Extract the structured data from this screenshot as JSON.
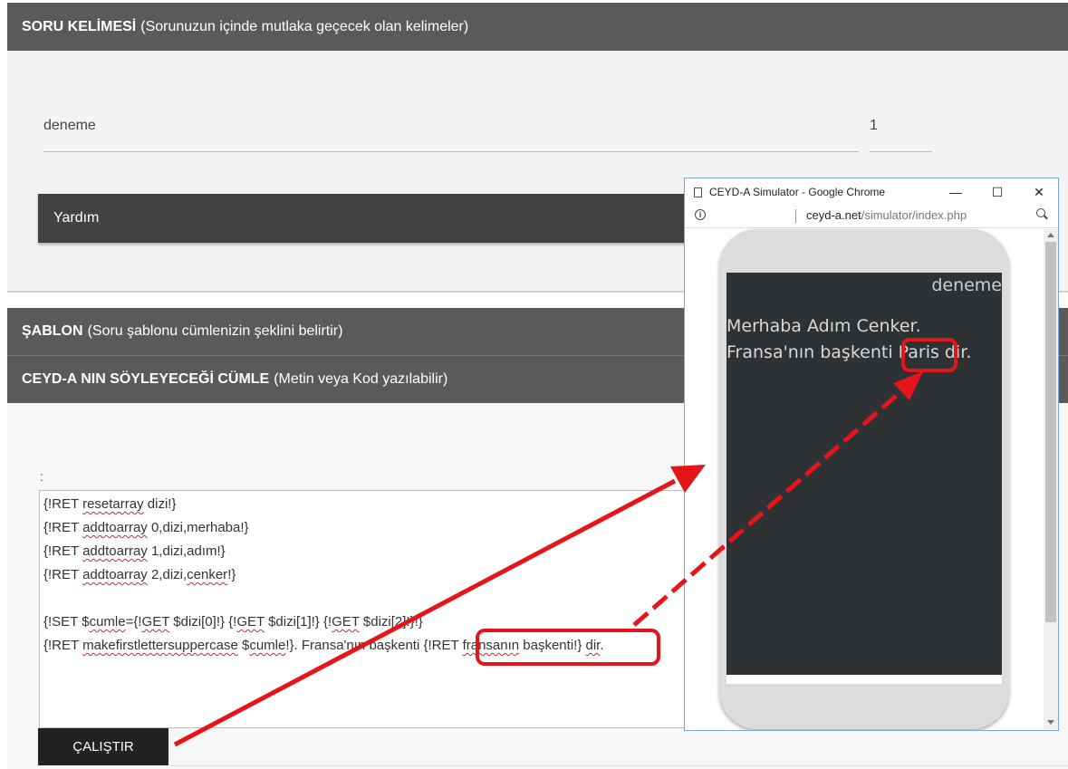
{
  "sections": {
    "soru_kelimesi": {
      "title_bold": "SORU KELİMESİ",
      "title_rest": "(Sorunuzun içinde mutlaka geçecek olan kelimeler)"
    },
    "sablon": {
      "title_bold": "ŞABLON",
      "title_rest": "(Soru şablonu cümlenizin şeklini belirtir)"
    },
    "cumle": {
      "title_bold": "CEYD-A NIN SÖYLEYECEĞİ CÜMLE",
      "title_rest": "(Metin veya Kod yazılabilir)"
    }
  },
  "keyword": {
    "value": "deneme",
    "count": "1"
  },
  "help_label": "Yardım",
  "colon_label": ":",
  "code": {
    "l1a": "{!RET ",
    "l1b": "resetarray",
    "l1c": " dizi!}",
    "l2a": "{!RET ",
    "l2b": "addtoarray",
    "l2c": " 0,dizi,merhaba!}",
    "l3a": "{!RET ",
    "l3b": "addtoarray",
    "l3c": " 1,dizi,adım!}",
    "l4a": "{!RET ",
    "l4b": "addtoarray",
    "l4c": " 2,dizi,",
    "l4d": "cenker",
    "l4e": "!}",
    "l5a": "{!SET $",
    "l5b": "cumle",
    "l5c": "={!",
    "l5d": "GET",
    "l5e": " $dizi[0]!} {!",
    "l5f": "GET",
    "l5g": " $dizi[1]!} {!",
    "l5h": "GET",
    "l5i": " $dizi[2]!}!}",
    "l6a": "{!RET ",
    "l6b": "makefirstlettersuppercase",
    "l6c": " $",
    "l6d": "cumle",
    "l6e": "!}. Fransa'nın başkenti ",
    "l6f": "{!RET ",
    "l6g": "fransanın",
    "l6h": " başkenti!}",
    "l6i": " ",
    "l6j": "dir",
    "l6k": "."
  },
  "run_button": "ÇALIŞTIR",
  "simulator": {
    "window_title": "CEYD-A Simulator - Google Chrome",
    "url_domain": "ceyd-a.net",
    "url_path": "/simulator/index.php",
    "minimize": "—",
    "maximize": "☐",
    "close": "✕",
    "keyword_echo": "deneme",
    "line1": "Merhaba Adım Cenker.",
    "line2_prefix": "Fransa'nın başkenti ",
    "line2_answer": "Paris",
    "line2_suffix": " dir."
  },
  "colors": {
    "annotation_red": "#e4151b",
    "header_gray": "#5a5a5a",
    "help_bar": "#424242",
    "button_black": "#222222",
    "phone_screen": "#2f3235"
  }
}
